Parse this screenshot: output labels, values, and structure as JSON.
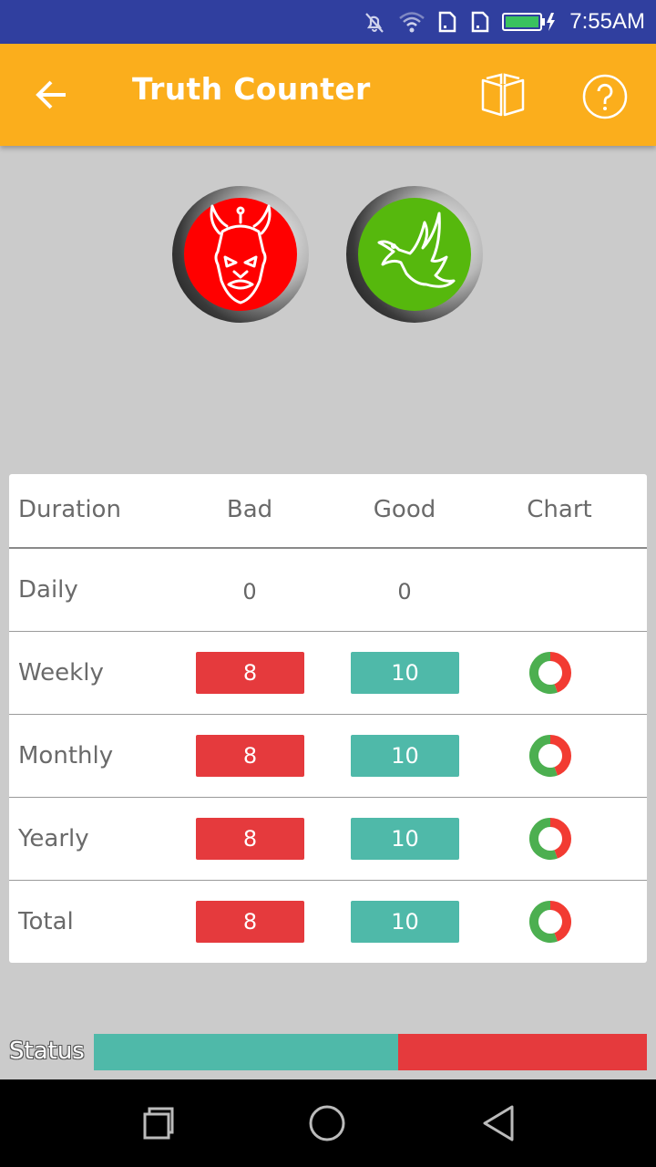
{
  "status_bar": {
    "time": "7:55AM",
    "icons": [
      "notifications-off-icon",
      "wifi-icon",
      "sim-card-icon",
      "sim-card-icon",
      "battery-charging-icon"
    ]
  },
  "app_bar": {
    "title": "Truth Counter",
    "icons": [
      "back-arrow-icon",
      "book-icon",
      "help-icon"
    ],
    "color": "#fbae1c"
  },
  "buttons": {
    "bad_icon": "devil-icon",
    "good_icon": "dove-icon",
    "bad_color": "#ff0000",
    "good_color": "#56b80d"
  },
  "table": {
    "headers": {
      "duration": "Duration",
      "bad": "Bad",
      "good": "Good",
      "chart": "Chart"
    },
    "rows": [
      {
        "label": "Daily",
        "bad": "0",
        "good": "0"
      },
      {
        "label": "Weekly",
        "bad": "8",
        "good": "10"
      },
      {
        "label": "Monthly",
        "bad": "8",
        "good": "10"
      },
      {
        "label": "Yearly",
        "bad": "8",
        "good": "10"
      },
      {
        "label": "Total",
        "bad": "8",
        "good": "10"
      }
    ],
    "bad_color": "#e53a3d",
    "good_color": "#4fb9a9",
    "chart_bad_color": "#f23b32",
    "chart_good_color": "#4caf50"
  },
  "status": {
    "label": "Status",
    "good_fraction": 0.55,
    "bad_fraction": 0.45
  },
  "nav_bar": {
    "icons": [
      "recent-apps-icon",
      "home-icon",
      "back-triangle-icon"
    ]
  }
}
